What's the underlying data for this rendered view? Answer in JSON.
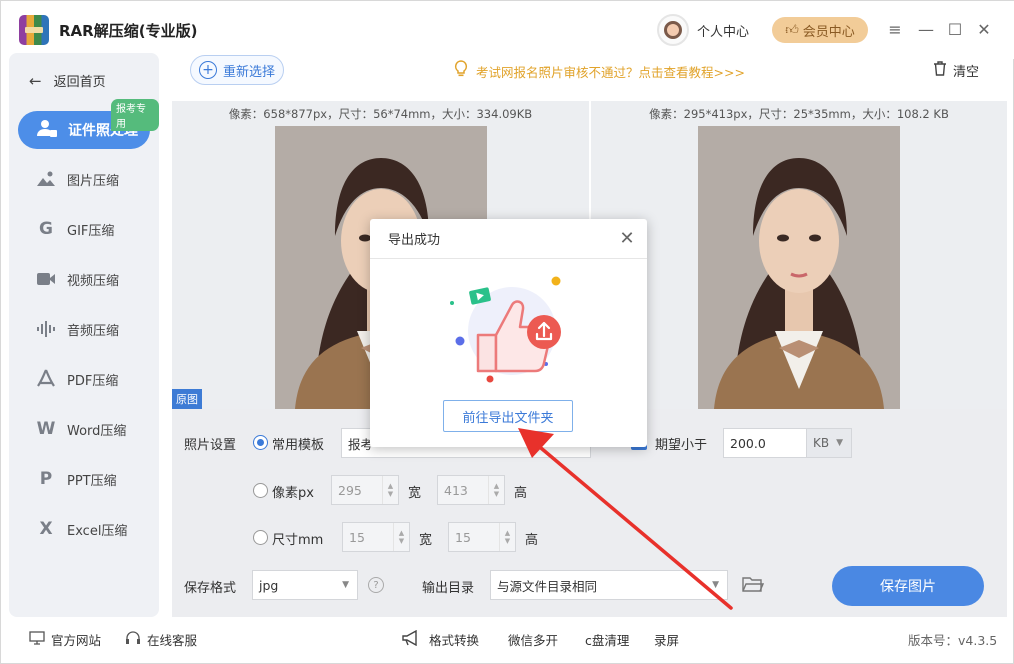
{
  "app": {
    "title": "RAR解压缩(专业版)"
  },
  "header": {
    "personal_center": "个人中心",
    "vip_center": "会员中心"
  },
  "sidebar": {
    "back": "返回首页",
    "active": {
      "label": "证件照处理",
      "tag": "报考专用"
    },
    "items": [
      {
        "label": "图片压缩",
        "icon": "image-icon"
      },
      {
        "label": "GIF压缩",
        "icon": "gif-icon"
      },
      {
        "label": "视频压缩",
        "icon": "video-icon"
      },
      {
        "label": "音频压缩",
        "icon": "audio-icon"
      },
      {
        "label": "PDF压缩",
        "icon": "pdf-icon"
      },
      {
        "label": "Word压缩",
        "icon": "word-icon"
      },
      {
        "label": "PPT压缩",
        "icon": "ppt-icon"
      },
      {
        "label": "Excel压缩",
        "icon": "excel-icon"
      }
    ]
  },
  "toolbar": {
    "reselect": "重新选择",
    "notice": "考试网报名照片审核不通过？点击查看教程>>>",
    "clear": "清空"
  },
  "preview": {
    "left_info": "像素：658*877px，尺寸：56*74mm，大小：334.09KB",
    "right_info": "像素：295*413px，尺寸：25*35mm，大小：108.2 KB",
    "original_badge": "原图"
  },
  "settings": {
    "photo_settings": "照片设置",
    "template": "常用模板",
    "template_value": "报考",
    "pixel_label": "像素px",
    "pixel_width": "295",
    "pixel_height": "413",
    "size_label": "尺寸mm",
    "size_width": "15",
    "size_height": "15",
    "width_label": "宽",
    "height_label": "高",
    "expect_label": "期望小于",
    "expect_value": "200.0",
    "expect_unit": "KB",
    "save_format_label": "保存格式",
    "save_format_value": "jpg",
    "output_dir_label": "输出目录",
    "output_dir_value": "与源文件目录相同",
    "save_button": "保存图片"
  },
  "footer": {
    "website": "官方网站",
    "support": "在线客服",
    "format_convert": "格式转换",
    "wechat": "微信多开",
    "disk_clean": "c盘清理",
    "record": "录屏",
    "version": "版本号：v4.3.5"
  },
  "dialog": {
    "title": "导出成功",
    "open_folder": "前往导出文件夹"
  },
  "colors": {
    "accent": "#4d8ee8",
    "notice": "#e1a32b",
    "vip": "#f2cc98",
    "arrow": "#e8312b"
  }
}
